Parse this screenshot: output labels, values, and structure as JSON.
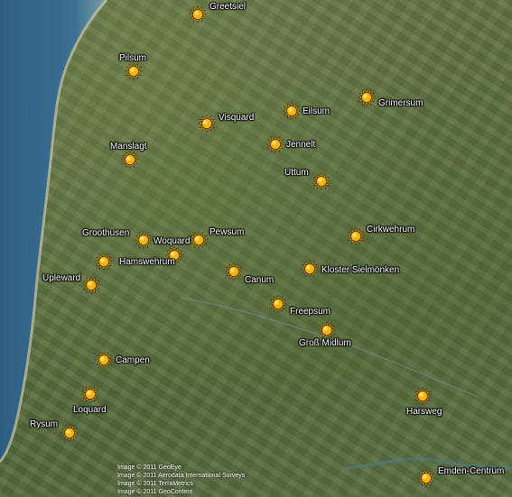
{
  "places": [
    {
      "name": "Greetsiel"
    },
    {
      "name": "Pilsum"
    },
    {
      "name": "Grimersum"
    },
    {
      "name": "Eilsum"
    },
    {
      "name": "Visquard"
    },
    {
      "name": "Jennelt"
    },
    {
      "name": "Manslagt"
    },
    {
      "name": "Uttum"
    },
    {
      "name": "Cirkwehrum"
    },
    {
      "name": "Groothusen"
    },
    {
      "name": "Woquard"
    },
    {
      "name": "Pewsum"
    },
    {
      "name": "Hamswehrum"
    },
    {
      "name": "Kloster Sielmönken"
    },
    {
      "name": "Upleward"
    },
    {
      "name": "Canum"
    },
    {
      "name": "Freepsum"
    },
    {
      "name": "Groß Midlum"
    },
    {
      "name": "Campen"
    },
    {
      "name": "Loquard"
    },
    {
      "name": "Harsweg"
    },
    {
      "name": "Rysum"
    },
    {
      "name": "Emden-Centrum"
    }
  ],
  "marker_icon": "sun-icon",
  "credits": [
    "Image © 2011 GeoEye",
    "Image © 2011 Aerodata International Surveys",
    "Image © 2011 TerraMetrics",
    "Image © 2011 GeoContent"
  ],
  "colors": {
    "sea": "#3d6a8c",
    "marker": "#f5b50a",
    "marker_outline": "#5a3a00"
  }
}
